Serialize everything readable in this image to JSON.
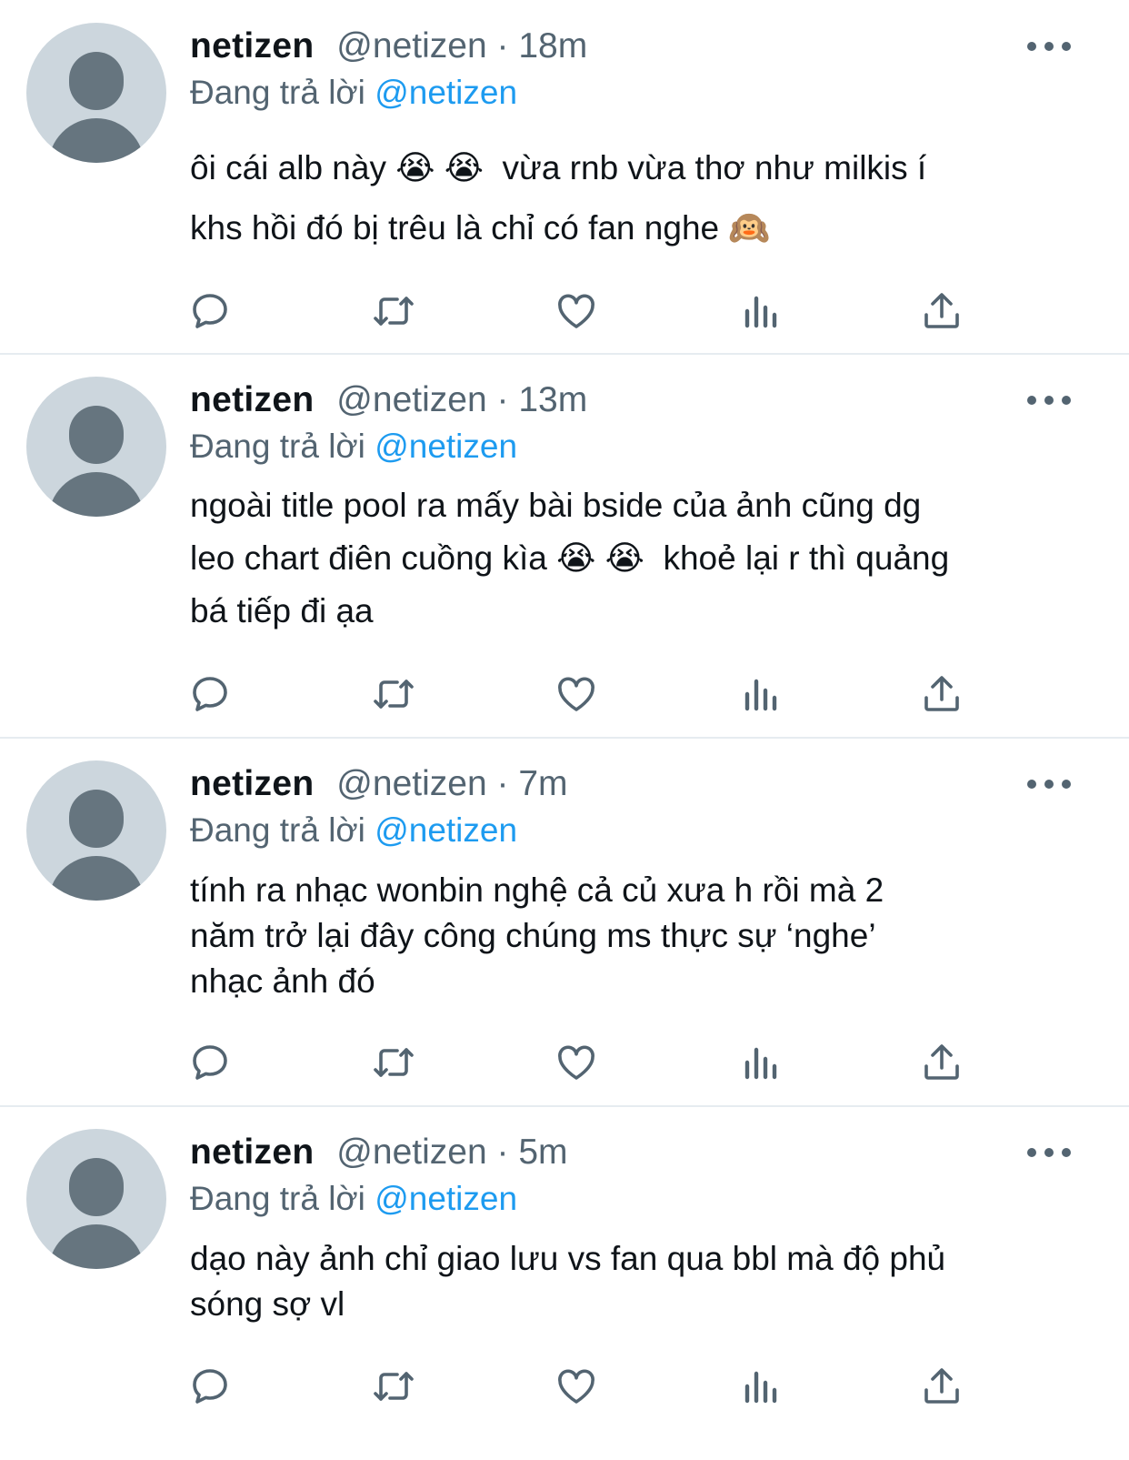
{
  "tweets": [
    {
      "name": "netizen",
      "handle": "@netizen",
      "separator": "·",
      "time": "18m",
      "reply_prefix": "Đang trả lời",
      "reply_to": "@netizen",
      "text": "ôi cái alb này 😭 😭  vừa rnb vừa thơ như milkis í\nkhs hồi đó bị trêu là chỉ có fan nghe 🙉"
    },
    {
      "name": "netizen",
      "handle": "@netizen",
      "separator": "·",
      "time": "13m",
      "reply_prefix": "Đang trả lời",
      "reply_to": "@netizen",
      "text": "ngoài title pool ra mấy bài bside của ảnh cũng dg\nleo chart điên cuồng kìa 😭 😭  khoẻ lại r thì quảng\nbá tiếp đi ạa"
    },
    {
      "name": "netizen",
      "handle": "@netizen",
      "separator": "·",
      "time": "7m",
      "reply_prefix": "Đang trả lời",
      "reply_to": "@netizen",
      "text": "tính ra nhạc wonbin nghệ cả củ xưa h rồi mà 2\nnăm trở lại đây công chúng ms thực sự ‘nghe’\nnhạc ảnh đó"
    },
    {
      "name": "netizen",
      "handle": "@netizen",
      "separator": "·",
      "time": "5m",
      "reply_prefix": "Đang trả lời",
      "reply_to": "@netizen",
      "text": "dạo này ảnh chỉ giao lưu vs fan qua bbl mà độ phủ\nsóng sợ vl"
    }
  ],
  "icons": {
    "reply": "reply-icon",
    "retweet": "retweet-icon",
    "like": "heart-icon",
    "views": "analytics-icon",
    "share": "share-icon",
    "more": "more-icon"
  },
  "colors": {
    "text": "#0f1419",
    "secondary": "#536471",
    "mention": "#1d9bf0",
    "avatar_bg": "#ccd6dd",
    "avatar_fg": "#66757f",
    "divider": "#e6ecf0"
  }
}
